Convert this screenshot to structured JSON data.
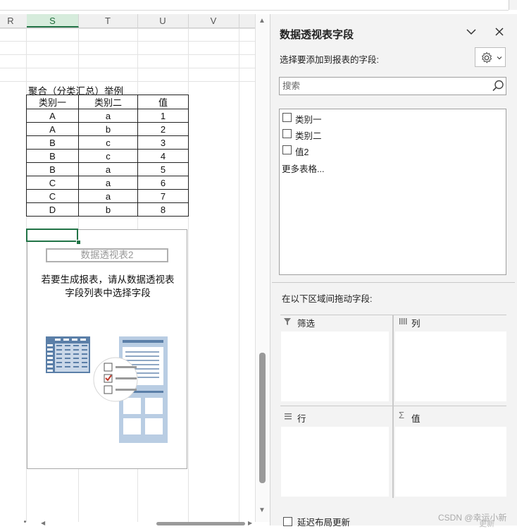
{
  "sheet": {
    "column_headers": [
      "R",
      "S",
      "T",
      "U",
      "V"
    ],
    "selected_column": "S",
    "table_title": "聚合（分类汇总）举例",
    "table": {
      "headers": [
        "类别一",
        "类别二",
        "值"
      ],
      "rows": [
        [
          "A",
          "a",
          "1"
        ],
        [
          "A",
          "b",
          "2"
        ],
        [
          "B",
          "c",
          "3"
        ],
        [
          "B",
          "c",
          "4"
        ],
        [
          "B",
          "a",
          "5"
        ],
        [
          "C",
          "a",
          "6"
        ],
        [
          "C",
          "a",
          "7"
        ],
        [
          "D",
          "b",
          "8"
        ]
      ]
    },
    "pivot": {
      "name": "数据透视表2",
      "hint_line1": "若要生成报表，请从数据透视表",
      "hint_line2": "字段列表中选择字段"
    }
  },
  "pane": {
    "title": "数据透视表字段",
    "subtitle": "选择要添加到报表的字段:",
    "search_placeholder": "搜索",
    "fields": [
      {
        "label": "类别一",
        "checked": false
      },
      {
        "label": "类别二",
        "checked": false
      },
      {
        "label": "值2",
        "checked": false
      }
    ],
    "more_tables": "更多表格...",
    "drag_label": "在以下区域间拖动字段:",
    "areas": {
      "filters": "筛选",
      "columns": "列",
      "rows": "行",
      "values": "值"
    },
    "defer_update": "延迟布局更新",
    "update_button": "更新"
  },
  "watermark": "CSDN @幸运小新",
  "colors": {
    "accent_green": "#217346",
    "pane_bg": "#f3f3f3",
    "illustration_blue": "#5b7fa8"
  }
}
